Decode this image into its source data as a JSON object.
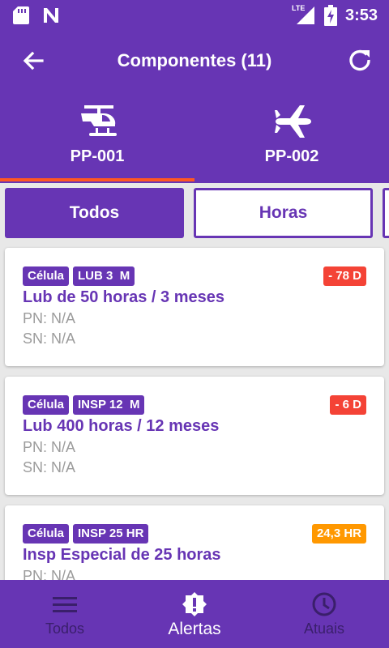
{
  "status_bar": {
    "time": "3:53",
    "network": "LTE"
  },
  "app_bar": {
    "title": "Componentes (11)"
  },
  "aircraft_tabs": [
    {
      "label": "PP-001",
      "icon": "helicopter-icon",
      "selected": true
    },
    {
      "label": "PP-002",
      "icon": "airplane-icon",
      "selected": false
    }
  ],
  "filters": [
    {
      "label": "Todos",
      "active": true
    },
    {
      "label": "Horas",
      "active": false
    }
  ],
  "cards": [
    {
      "badge1": "Célula",
      "badge2": "LUB 3  M",
      "due": "- 78 D",
      "due_color": "#f44336",
      "title": "Lub de 50 horas / 3 meses",
      "pn": "PN: N/A",
      "sn": "SN: N/A"
    },
    {
      "badge1": "Célula",
      "badge2": "INSP 12  M",
      "due": "- 6 D",
      "due_color": "#f44336",
      "title": "Lub 400 horas / 12 meses",
      "pn": "PN: N/A",
      "sn": "SN: N/A"
    },
    {
      "badge1": "Célula",
      "badge2": "INSP 25 HR",
      "due": "24,3 HR",
      "due_color": "#ff9800",
      "title": "Insp Especial de 25 horas",
      "pn": "PN: N/A",
      "sn": ""
    }
  ],
  "bottom_nav": [
    {
      "label": "Todos",
      "icon": "menu-icon",
      "active": false
    },
    {
      "label": "Alertas",
      "icon": "alert-icon",
      "active": true
    },
    {
      "label": "Atuais",
      "icon": "clock-icon",
      "active": false
    }
  ],
  "colors": {
    "primary": "#6735b4",
    "indicator": "#ff5722",
    "overdue": "#f44336",
    "warning": "#ff9800"
  }
}
